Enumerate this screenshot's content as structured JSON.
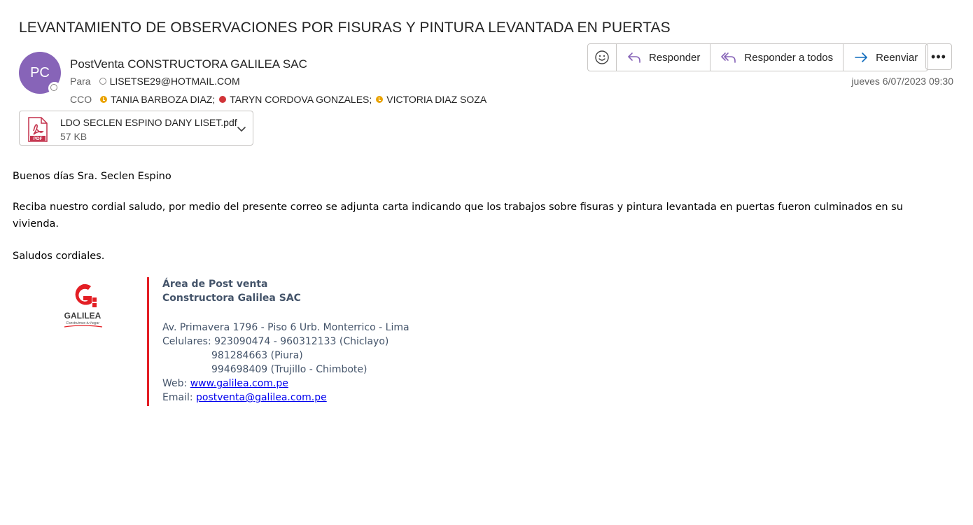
{
  "email": {
    "subject": "LEVANTAMIENTO DE OBSERVACIONES POR FISURAS Y PINTURA LEVANTADA EN PUERTAS",
    "sender": {
      "initials": "PC",
      "name": "PostVenta CONSTRUCTORA GALILEA SAC",
      "avatar_color": "#8764b8"
    },
    "to_label": "Para",
    "to": [
      {
        "name": "LISETSE29@HOTMAIL.COM",
        "status": "offline"
      }
    ],
    "cco_label": "CCO",
    "cco": [
      {
        "name": "TANIA BARBOZA DIAZ;",
        "status": "away"
      },
      {
        "name": "TARYN CORDOVA GONZALES;",
        "status": "busy"
      },
      {
        "name": "VICTORIA DIAZ SOZA",
        "status": "away"
      }
    ],
    "date": "jueves 6/07/2023 09:30"
  },
  "toolbar": {
    "emoji_icon": "emoji-icon",
    "reply_label": "Responder",
    "reply_all_label": "Responder a todos",
    "forward_label": "Reenviar",
    "more_label": "•••",
    "accent": "#8764b8"
  },
  "attachment": {
    "name": "LDO SECLEN ESPINO DANY LISET.pdf",
    "size": "57 KB",
    "icon": "pdf-icon"
  },
  "body": {
    "greeting": "Buenos días Sra. Seclen Espino",
    "paragraph": "Reciba nuestro cordial saludo, por medio del presente correo se adjunta carta indicando que los trabajos sobre fisuras y pintura levantada en puertas fueron culminados en su vivienda.",
    "closing": "Saludos cordiales."
  },
  "signature": {
    "logo_text": "GALILEA",
    "logo_tagline": "Construimos tu hogar",
    "line1": "Área de Post venta",
    "line2": "Constructora Galilea SAC",
    "address": "Av. Primavera 1796 - Piso 6 Urb. Monterrico - Lima",
    "phones_label": "Celulares:",
    "phone1": "923090474 - 960312133 (Chiclayo)",
    "phone2": "981284663 (Piura)",
    "phone3": "994698409 (Trujillo - Chimbote)",
    "web_label": "Web:",
    "web": "www.galilea.com.pe",
    "email_label": "Email:",
    "email": "postventa@galilea.com.pe",
    "accent": "#e31e24"
  }
}
